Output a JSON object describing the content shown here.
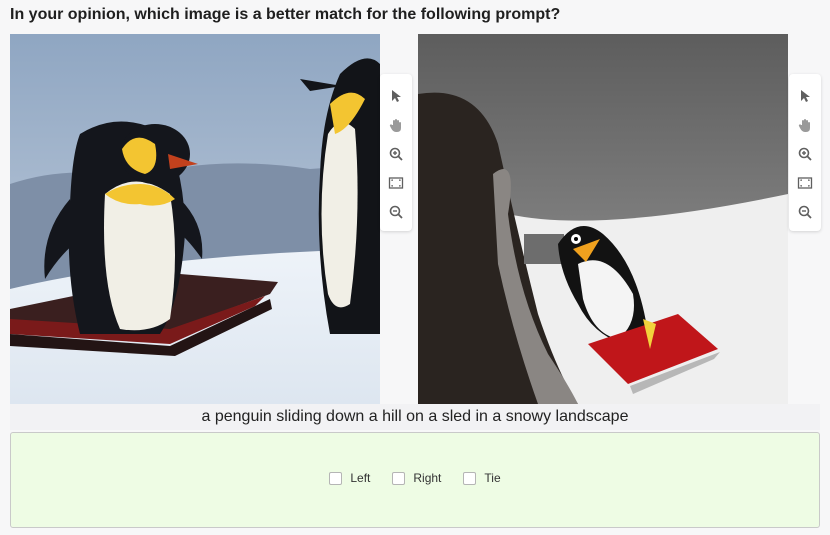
{
  "question": "In your opinion, which image is a better match for the following prompt?",
  "prompt_text": "a penguin sliding down a hill on a sled in a snowy landscape",
  "options": [
    {
      "label": "Left"
    },
    {
      "label": "Right"
    },
    {
      "label": "Tie"
    }
  ],
  "toolbar_icons": [
    "pointer-icon",
    "hand-icon",
    "zoom-in-icon",
    "fit-screen-icon",
    "zoom-out-icon"
  ],
  "colors": {
    "choice_background": "#eefce4",
    "prompt_background": "#f2f2f4"
  }
}
